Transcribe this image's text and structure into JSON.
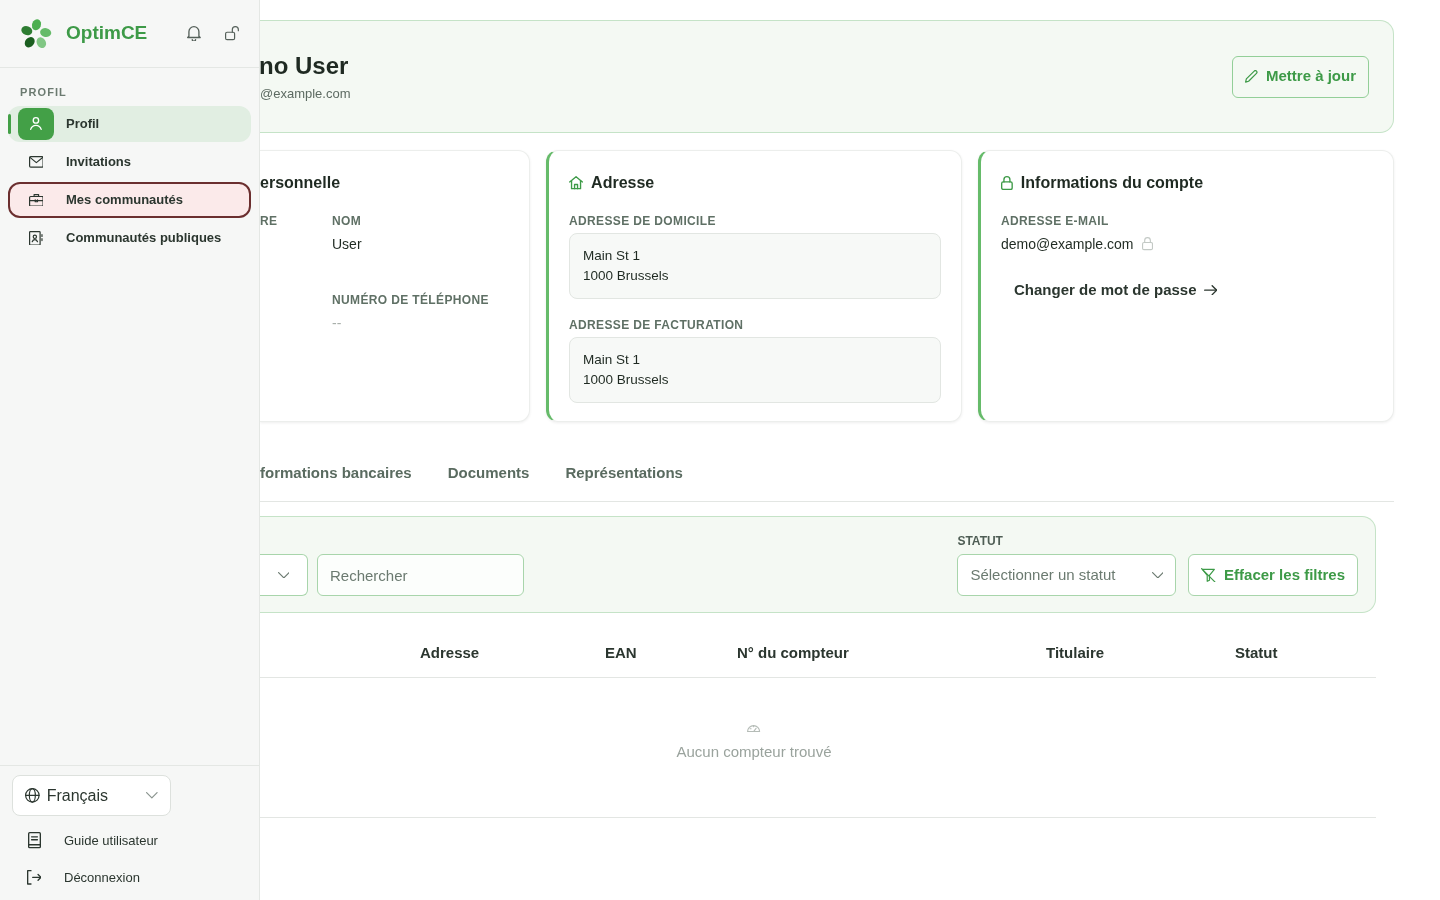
{
  "sidebar": {
    "brand": "OptimCE",
    "section_label": "PROFIL",
    "items": [
      {
        "label": "Profil",
        "selected": true,
        "focused": false
      },
      {
        "label": "Invitations",
        "selected": false,
        "focused": false
      },
      {
        "label": "Mes communautés",
        "selected": false,
        "focused": true
      },
      {
        "label": "Communautés publiques",
        "selected": false,
        "focused": false
      }
    ],
    "language": {
      "value": "Français"
    },
    "footer_links": [
      "Guide utilisateur",
      "Déconnexion"
    ]
  },
  "profile_header": {
    "name": "no User",
    "email": "@example.com",
    "button": "Mettre à jour"
  },
  "cards": [
    {
      "kind": "personal",
      "title": "ersonnelle",
      "columns": [
        [
          {
            "label": "RE"
          }
        ],
        [
          {
            "label": "NOM",
            "value": "User",
            "empty": false
          },
          {
            "label": "NUMÉRO DE TÉLÉPHONE",
            "value": "--",
            "empty": true
          }
        ]
      ]
    },
    {
      "kind": "address",
      "title": "Adresse",
      "sections": [
        {
          "label": "ADRESSE DE DOMICILE",
          "lines": [
            "Main St 1",
            "1000 Brussels"
          ]
        },
        {
          "label": "ADRESSE DE FACTURATION",
          "lines": [
            "Main St 1",
            "1000 Brussels"
          ]
        }
      ]
    },
    {
      "kind": "account",
      "title": "Informations du compte",
      "email_label": "ADRESSE E-MAIL",
      "email": "demo@example.com",
      "link": "Changer de mot de passe"
    }
  ],
  "tabs": [
    {
      "label": "formations bancaires",
      "selected": false
    },
    {
      "label": "Documents",
      "selected": false
    },
    {
      "label": "Représentations",
      "selected": false
    }
  ],
  "filters": {
    "search": {
      "placeholder": "Rechercher"
    },
    "status": {
      "label": "STATUT",
      "placeholder": "Sélectionner un statut"
    },
    "clear_button": "Effacer les filtres"
  },
  "table": {
    "columns": [
      "Adresse",
      "EAN",
      "N° du compteur",
      "Titulaire",
      "Statut"
    ],
    "empty_message": "Aucun compteur trouvé"
  }
}
